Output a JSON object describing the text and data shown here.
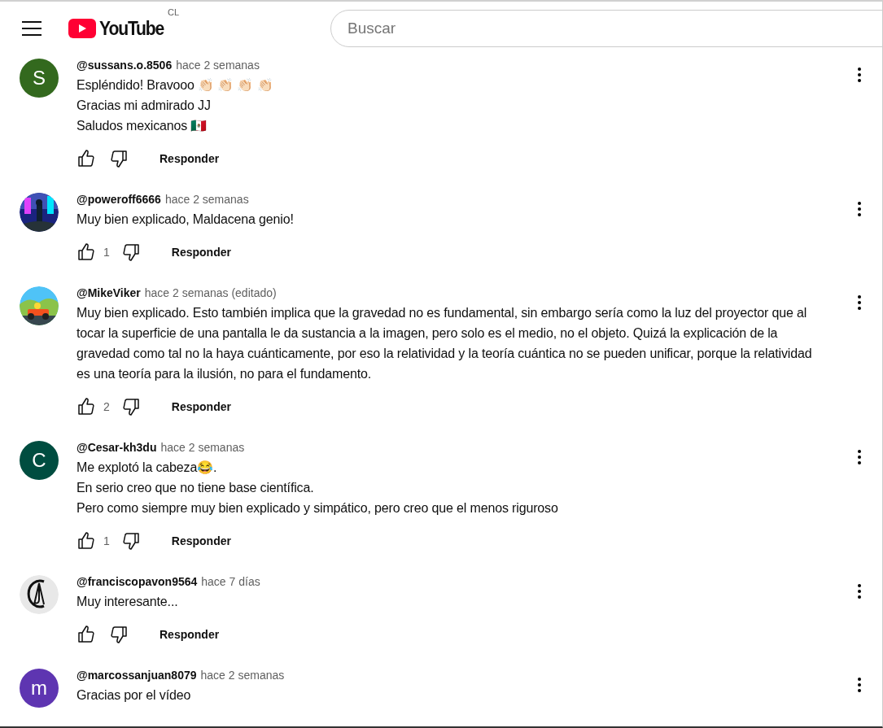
{
  "header": {
    "logo_text": "YouTube",
    "country": "CL",
    "search": {
      "placeholder": "Buscar"
    }
  },
  "comments": [
    {
      "avatar": {
        "kind": "letter",
        "letter": "S",
        "color": "#33691e"
      },
      "author": "@sussans.o.8506",
      "time": "hace 2 semanas",
      "text": "Espléndido! Bravooo 👏🏻 👏🏻 👏🏻 👏🏻\nGracias mi admirado JJ\nSaludos mexicanos 🇲🇽",
      "reply": "Responder"
    },
    {
      "author": "@poweroff6666",
      "time": "hace 2 semanas",
      "text": "Muy bien explicado, Maldacena genio!",
      "likes": "1",
      "reply": "Responder"
    },
    {
      "author": "@MikeViker",
      "time": "hace 2 semanas (editado)",
      "text": "Muy bien explicado. Esto también implica que la gravedad no es fundamental, sin embargo sería como la luz del proyector que al tocar la superficie de una pantalla le da sustancia a la imagen, pero solo es el medio, no el objeto. Quizá la explicación de la gravedad como tal no la haya cuánticamente, por eso la relatividad y la teoría cuántica no se pueden unificar, porque la relatividad es una teoría para la ilusión, no para el fundamento.",
      "likes": "2",
      "reply": "Responder"
    },
    {
      "avatar": {
        "kind": "letter",
        "letter": "C",
        "color": "#004d40"
      },
      "author": "@Cesar-kh3du",
      "time": "hace 2 semanas",
      "text": "Me explotó la cabeza😂.\nEn serio creo que no tiene base científica.\nPero como siempre muy bien explicado y simpático, pero creo que el menos riguroso",
      "likes": "1",
      "reply": "Responder"
    },
    {
      "author": "@franciscopavon9564",
      "time": "hace 7 días",
      "text": "Muy interesante...",
      "reply": "Responder"
    },
    {
      "avatar": {
        "kind": "letter",
        "letter": "m",
        "color": "#5e35b1"
      },
      "author": "@marcossanjuan8079",
      "time": "hace 2 semanas",
      "text": "Gracias por el vídeo"
    }
  ]
}
